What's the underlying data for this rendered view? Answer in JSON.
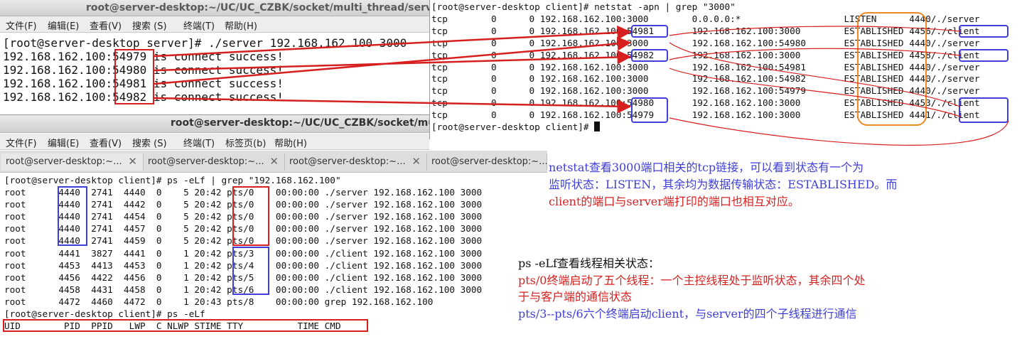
{
  "window1": {
    "title": "root@server-desktop:~/UC/UC_CZBK/socket/multi_thread/server",
    "menu": [
      "文件(F)",
      "编辑(E)",
      "查看(V)",
      "搜索 (S)",
      "终端(T)",
      "帮助(H)"
    ],
    "lines": [
      "[root@server-desktop server]# ./server 192.168.162.100 3000",
      "192.168.162.100:54979 is connect success!",
      "192.168.162.100:54980 is connect success!",
      "192.168.162.100:54981 is connect success!",
      "192.168.162.100:54982 is connect success!"
    ]
  },
  "window2": {
    "title": "root@server-desktop:~/UC/UC_CZBK/socket/multi_thread/server",
    "menu": [
      "文件(F)",
      "编辑(E)",
      "查看(V)",
      "搜索 (S)",
      "终端(T)",
      "标签页(b)",
      "帮助(H)"
    ],
    "tabs": [
      "root@server-desktop:~...",
      "root@server-desktop:~...",
      "root@server-desktop:~...",
      "root@server-desktop:~..."
    ],
    "lines": [
      "[root@server-desktop client]# ps -eLf | grep \"192.168.162.100\"",
      "root      4440  2741  4440  0    5 20:42 pts/0    00:00:00 ./server 192.168.162.100 3000",
      "root      4440  2741  4442  0    5 20:42 pts/0    00:00:00 ./server 192.168.162.100 3000",
      "root      4440  2741  4454  0    5 20:42 pts/0    00:00:00 ./server 192.168.162.100 3000",
      "root      4440  2741  4457  0    5 20:42 pts/0    00:00:00 ./server 192.168.162.100 3000",
      "root      4440  2741  4459  0    5 20:42 pts/0    00:00:00 ./server 192.168.162.100 3000",
      "root      4441  3827  4441  0    1 20:42 pts/3    00:00:00 ./client 192.168.162.100 3000",
      "root      4453  4413  4453  0    1 20:42 pts/4    00:00:00 ./client 192.168.162.100 3000",
      "root      4456  4422  4456  0    1 20:42 pts/5    00:00:00 ./client 192.168.162.100 3000",
      "root      4458  4431  4458  0    1 20:42 pts/6    00:00:00 ./client 192.168.162.100 3000",
      "root      4472  4460  4472  0    1 20:43 pts/8    00:00:00 grep 192.168.162.100",
      "[root@server-desktop client]# ps -eLf",
      "UID        PID  PPID   LWP  C NLWP STIME TTY          TIME CMD"
    ]
  },
  "window3": {
    "prompt_cmd": "[root@server-desktop client]# netstat -apn | grep \"3000\"",
    "lines": [
      "tcp        0      0 192.168.162.100:3000        0.0.0.0:*                   LISTEN      4440/./server",
      "tcp        0      0 192.168.162.100:54981       192.168.162.100:3000        ESTABLISHED 4456/./client",
      "tcp        0      0 192.168.162.100:3000        192.168.162.100:54980       ESTABLISHED 4440/./server",
      "tcp        0      0 192.168.162.100:54982       192.168.162.100:3000        ESTABLISHED 4458/./client",
      "tcp        0      0 192.168.162.100:3000        192.168.162.100:54981       ESTABLISHED 4440/./server",
      "tcp        0      0 192.168.162.100:3000        192.168.162.100:54982       ESTABLISHED 4440/./server",
      "tcp        0      0 192.168.162.100:3000        192.168.162.100:54979       ESTABLISHED 4440/./server",
      "tcp        0      0 192.168.162.100:54980       192.168.162.100:3000        ESTABLISHED 4453/./client",
      "tcp        0      0 192.168.162.100:54979       192.168.162.100:3000        ESTABLISHED 4441/./client"
    ],
    "prompt_final": "[root@server-desktop client]# "
  },
  "annotations": {
    "netstat": [
      "netstat查看3000端口相关的tcp链接，可以看到状态有一个为",
      "监听状态：LISTEN，其余均为数据传输状态：ESTABLISHED。而",
      "client的端口与server端打印的端口也相互对应。"
    ],
    "ps": [
      "ps -eLf查看线程相关状态：",
      "pts/0终端启动了五个线程：一个主控线程处于监听状态，其余四个处",
      "于与客户端的通信状态",
      "pts/3--pts/6六个终端启动client，与server的四个子线程进行通信"
    ]
  },
  "colors": {
    "red": "#d81f1f",
    "blue": "#3e3ed8",
    "orange": "#f08a24"
  }
}
